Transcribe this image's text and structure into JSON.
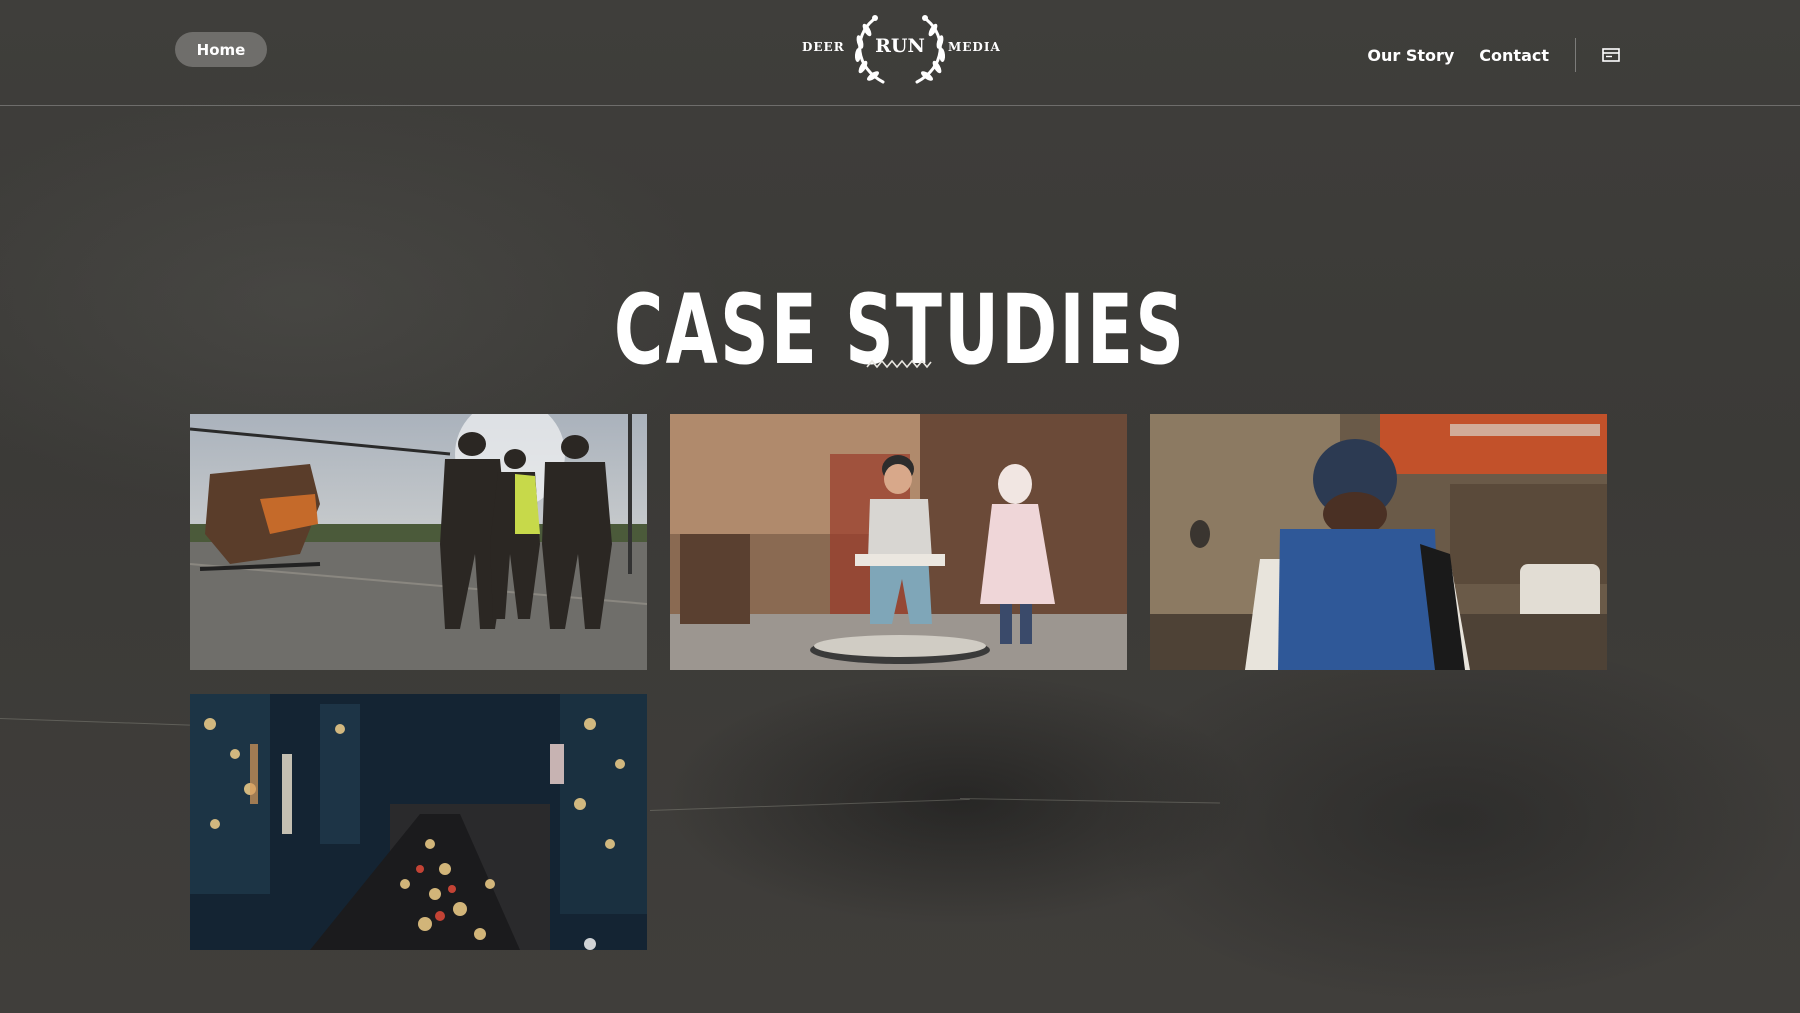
{
  "header": {
    "home_label": "Home",
    "logo": {
      "left": "DEER",
      "center": "RUN",
      "right": "MEDIA"
    },
    "nav": [
      "Our Story",
      "Contact"
    ],
    "cart_icon": "cart-icon"
  },
  "main": {
    "title": "CASE STUDIES",
    "divider_icon": "zigzag-divider-icon"
  },
  "case_studies": [
    {
      "thumb": "helicopter-crew-thumbnail"
    },
    {
      "thumb": "workshop-chair-girl-thumbnail"
    },
    {
      "thumb": "cafe-man-beanie-thumbnail"
    },
    {
      "thumb": "city-traffic-night-thumbnail"
    }
  ],
  "colors": {
    "background": "#3d3c39",
    "text": "#ffffff",
    "home_button": "#6f6e6b"
  }
}
